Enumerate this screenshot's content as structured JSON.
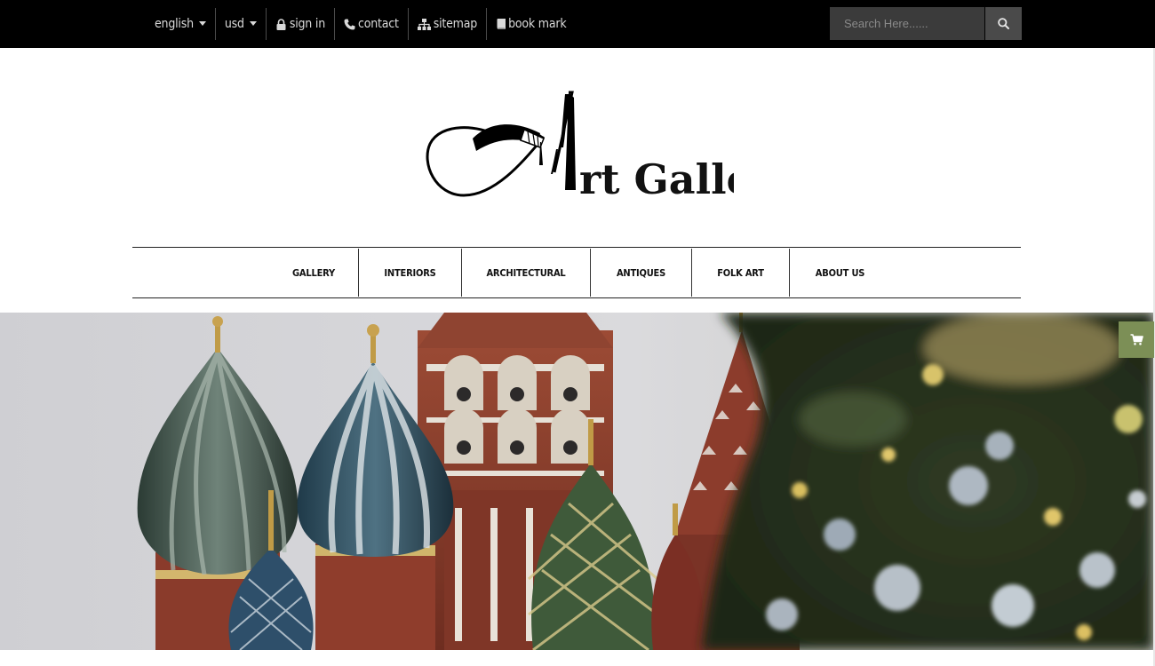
{
  "topbar": {
    "language": {
      "label": "english",
      "icon": "chevron-down-icon"
    },
    "currency": {
      "label": "usd",
      "icon": "chevron-down-icon"
    },
    "links": [
      {
        "label": "sign in",
        "icon": "lock-icon"
      },
      {
        "label": "contact",
        "icon": "phone-icon"
      },
      {
        "label": "sitemap",
        "icon": "sitemap-icon"
      },
      {
        "label": "book mark",
        "icon": "bookmark-icon"
      }
    ],
    "search": {
      "placeholder": "Search Here......",
      "value": "",
      "icon": "search-icon"
    }
  },
  "logo": {
    "text": "Art Gallery"
  },
  "nav": {
    "items": [
      {
        "label": "GALLERY"
      },
      {
        "label": "INTERIORS"
      },
      {
        "label": "ARCHITECTURAL"
      },
      {
        "label": "ANTIQUES"
      },
      {
        "label": "FOLK ART"
      },
      {
        "label": "ABOUT US"
      }
    ]
  },
  "hero": {
    "image": "Domes of a cathedral beside a blurred Christmas tree"
  },
  "cart": {
    "icon": "shopping-cart-icon"
  },
  "colors": {
    "topbar": "#000000",
    "cart_button": "#7c8f56",
    "search_bg": "#3b3b3b"
  }
}
